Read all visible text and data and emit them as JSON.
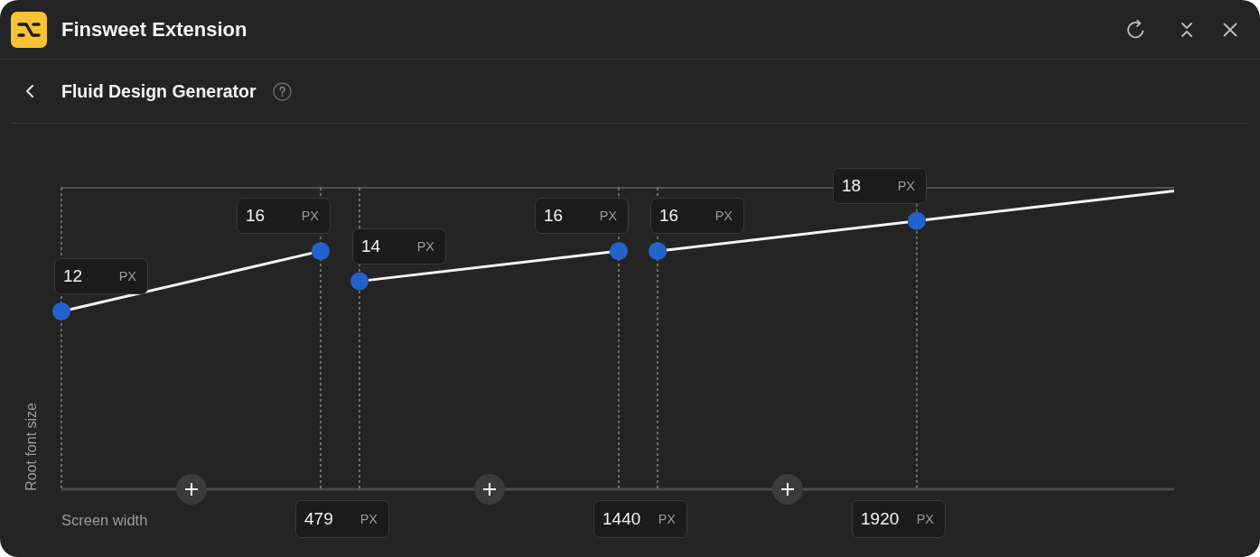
{
  "window": {
    "title": "Finsweet Extension"
  },
  "page": {
    "title": "Fluid Design Generator"
  },
  "chart": {
    "ylabel": "Root font size",
    "xlabel": "Screen width",
    "ranges": [
      {
        "start": {
          "value": "12",
          "unit": "PX",
          "level": 0.59
        },
        "end": {
          "value": "16",
          "unit": "PX",
          "level": 0.79
        },
        "breakpoint": {
          "value": "479",
          "unit": "PX"
        }
      },
      {
        "start": {
          "value": "14",
          "unit": "PX",
          "level": 0.69
        },
        "end": {
          "value": "16",
          "unit": "PX",
          "level": 0.79
        },
        "breakpoint": {
          "value": "1440",
          "unit": "PX"
        }
      },
      {
        "start": {
          "value": "16",
          "unit": "PX",
          "level": 0.79
        },
        "end": {
          "value": "18",
          "unit": "PX",
          "level": 0.89
        },
        "breakpoint": {
          "value": "1920",
          "unit": "PX"
        }
      }
    ]
  }
}
